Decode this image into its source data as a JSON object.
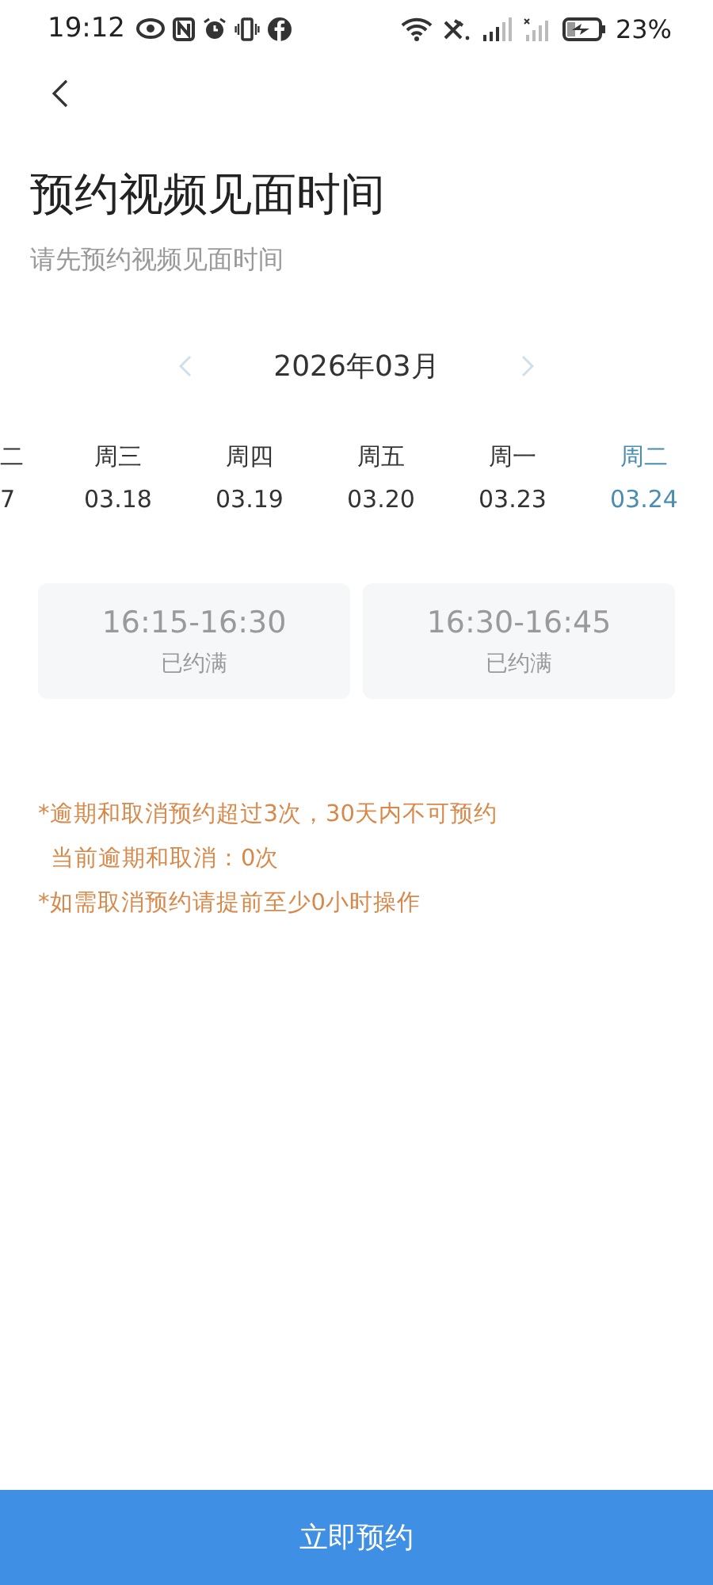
{
  "status_bar": {
    "time": "19:12",
    "battery": "23%"
  },
  "title": "预约视频见面时间",
  "subtitle": "请先预约视频见面时间",
  "month": "2026年03月",
  "days": [
    {
      "weekday": "二",
      "date": "7",
      "selected": false,
      "cut": true
    },
    {
      "weekday": "周三",
      "date": "03.18",
      "selected": false
    },
    {
      "weekday": "周四",
      "date": "03.19",
      "selected": false
    },
    {
      "weekday": "周五",
      "date": "03.20",
      "selected": false
    },
    {
      "weekday": "周一",
      "date": "03.23",
      "selected": false
    },
    {
      "weekday": "周二",
      "date": "03.24",
      "selected": true
    }
  ],
  "slots": [
    {
      "time": "16:15-16:30",
      "status": "已约满",
      "disabled": true
    },
    {
      "time": "16:30-16:45",
      "status": "已约满",
      "disabled": true
    }
  ],
  "notes": [
    "*逾期和取消预约超过3次，30天内不可预约",
    "当前逾期和取消：0次",
    "*如需取消预约请提前至少0小时操作"
  ],
  "submit": "立即预约"
}
